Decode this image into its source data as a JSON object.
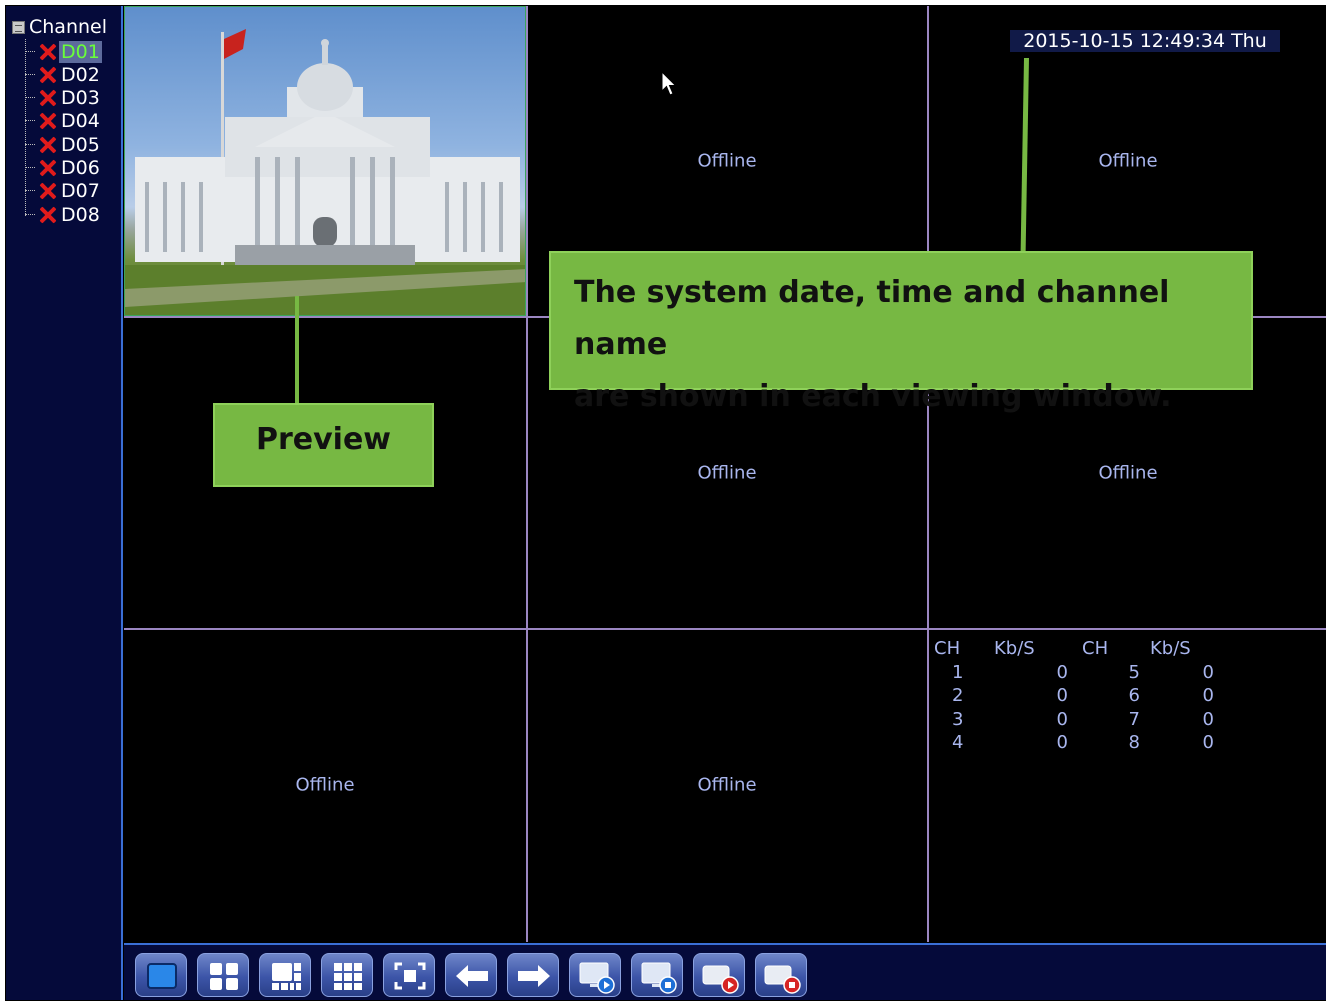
{
  "sidebar": {
    "root_label": "Channel",
    "channels": [
      {
        "label": "D01",
        "status_icon": "x-icon",
        "selected": true
      },
      {
        "label": "D02",
        "status_icon": "x-icon",
        "selected": false
      },
      {
        "label": "D03",
        "status_icon": "x-icon",
        "selected": false
      },
      {
        "label": "D04",
        "status_icon": "x-icon",
        "selected": false
      },
      {
        "label": "D05",
        "status_icon": "x-icon",
        "selected": false
      },
      {
        "label": "D06",
        "status_icon": "x-icon",
        "selected": false
      },
      {
        "label": "D07",
        "status_icon": "x-icon",
        "selected": false
      },
      {
        "label": "D08",
        "status_icon": "x-icon",
        "selected": false
      }
    ]
  },
  "grid": {
    "datetime": "2015-10-15 12:49:34 Thu",
    "offline_label": "Offline"
  },
  "stats": {
    "headers": [
      "CH",
      "Kb/S",
      "CH",
      "Kb/S"
    ],
    "rows": [
      [
        "1",
        "0",
        "5",
        "0"
      ],
      [
        "2",
        "0",
        "6",
        "0"
      ],
      [
        "3",
        "0",
        "7",
        "0"
      ],
      [
        "4",
        "0",
        "8",
        "0"
      ]
    ]
  },
  "callouts": {
    "preview": "Preview",
    "datetime_line1": "The system date, time and channel name",
    "datetime_line2": "are shown in each viewing window."
  },
  "toolbar": {
    "buttons": [
      "single-view-icon",
      "quad-view-icon",
      "six-view-icon",
      "nine-view-icon",
      "fullscreen-icon",
      "previous-icon",
      "next-icon",
      "start-sequence-icon",
      "stop-sequence-icon",
      "start-record-icon",
      "stop-record-icon"
    ]
  },
  "colors": {
    "accent_green": "#77b843",
    "offline_text": "#a9b6ee",
    "grid_line": "#9b86c2",
    "sidebar_bg": "#050a3a",
    "error_red": "#e11b1b"
  }
}
